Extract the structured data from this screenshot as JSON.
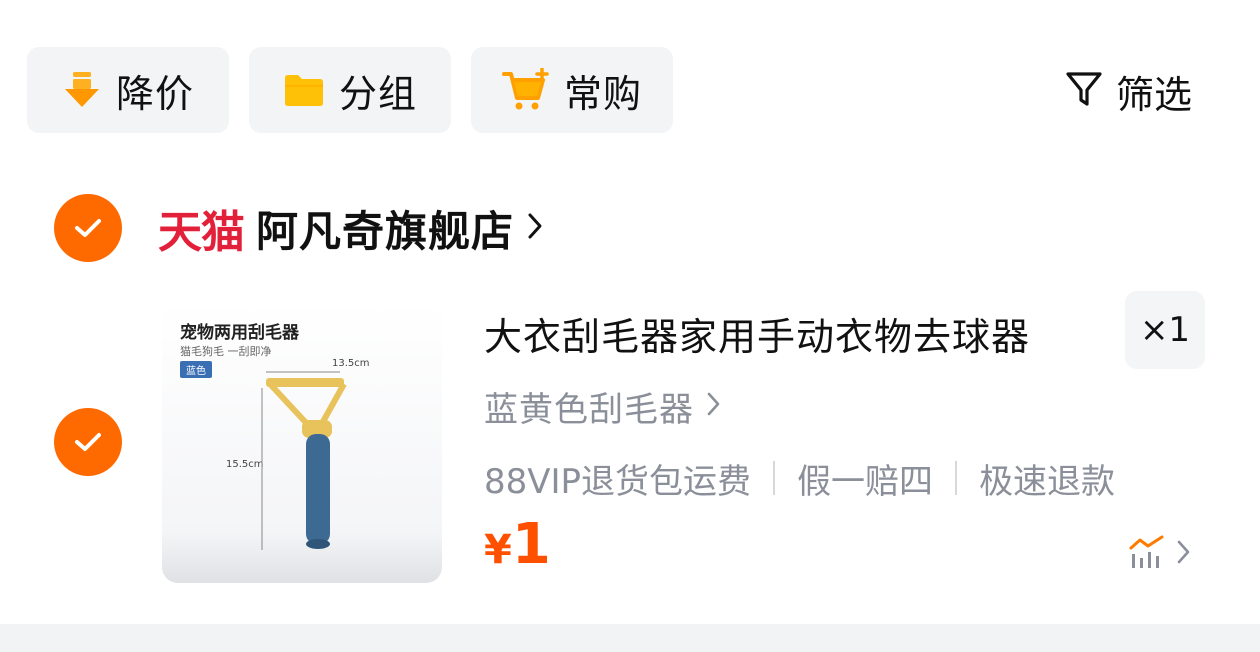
{
  "toolbar": {
    "chips": [
      {
        "label": "降价",
        "icon": "price-drop-icon"
      },
      {
        "label": "分组",
        "icon": "folder-icon"
      },
      {
        "label": "常购",
        "icon": "cart-plus-icon"
      }
    ],
    "filter_label": "筛选",
    "filter_icon": "filter-funnel-icon"
  },
  "store": {
    "brand": "天猫",
    "name": "阿凡奇旗舰店"
  },
  "item": {
    "title": "大衣刮毛器家用手动衣物去球器",
    "quantity": "×1",
    "spec": "蓝黄色刮毛器",
    "services": [
      "88VIP退货包运费",
      "假一赔四",
      "极速退款"
    ],
    "price_symbol": "¥",
    "price": "1",
    "image": {
      "title": "宠物两用刮毛器",
      "subtitle": "猫毛狗毛 一刮即净",
      "tag": "蓝色",
      "width_label": "13.5cm",
      "height_label": "15.5cm"
    }
  },
  "colors": {
    "accent_orange": "#ff6a00",
    "price_orange": "#ff5000",
    "tmall_red": "#e3203a",
    "chip_bg": "#f2f4f6",
    "muted_text": "#8a8f99"
  }
}
